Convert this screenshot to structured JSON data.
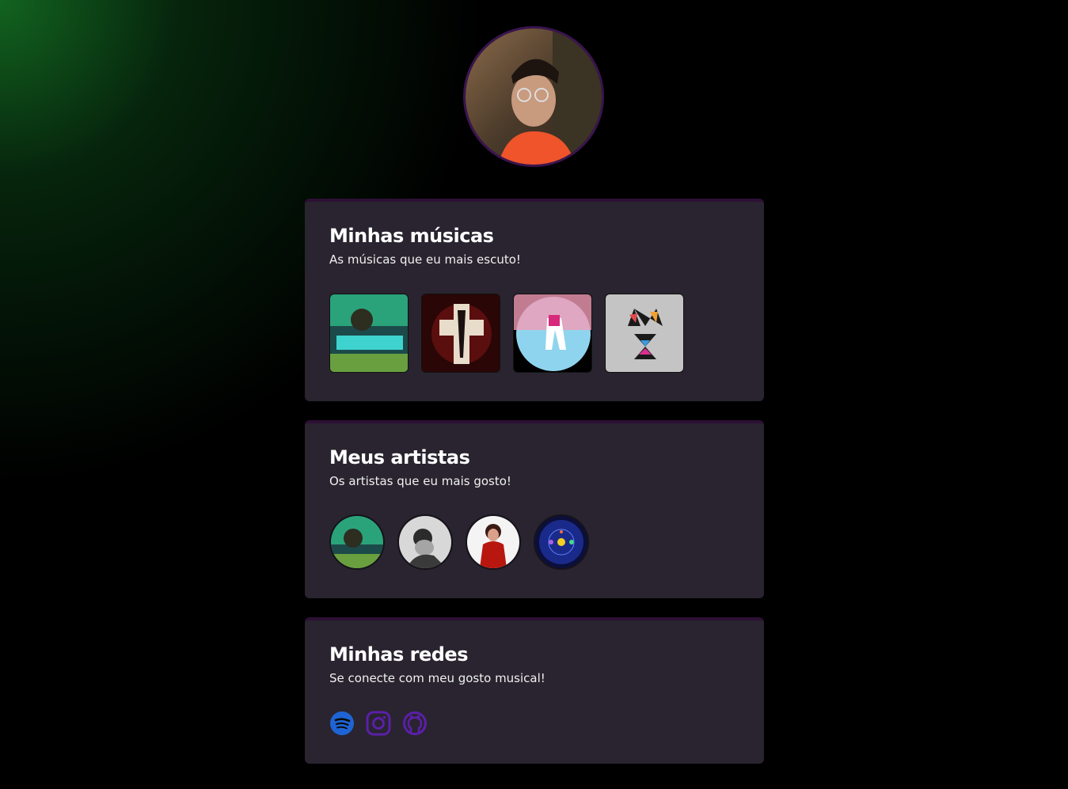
{
  "profile": {
    "avatar_icon": "profile-photo"
  },
  "songs": {
    "title": "Minhas músicas",
    "subtitle": "As músicas que eu mais escuto!",
    "albums": [
      {
        "name": "album-cover-1"
      },
      {
        "name": "album-cover-2"
      },
      {
        "name": "album-cover-3"
      },
      {
        "name": "album-cover-4"
      }
    ]
  },
  "artists": {
    "title": "Meus artistas",
    "subtitle": "Os artistas que eu mais gosto!",
    "items": [
      {
        "name": "artist-1"
      },
      {
        "name": "artist-2"
      },
      {
        "name": "artist-3"
      },
      {
        "name": "artist-4"
      }
    ]
  },
  "socials": {
    "title": "Minhas redes",
    "subtitle": "Se conecte com meu gosto musical!",
    "links": [
      {
        "icon": "spotify-icon",
        "color": "#1e64d4"
      },
      {
        "icon": "instagram-icon",
        "color": "#5b1fa8"
      },
      {
        "icon": "github-icon",
        "color": "#5b1fa8"
      }
    ]
  },
  "colors": {
    "background": "#000000",
    "card": "#29242f",
    "glow": "#146e23"
  }
}
